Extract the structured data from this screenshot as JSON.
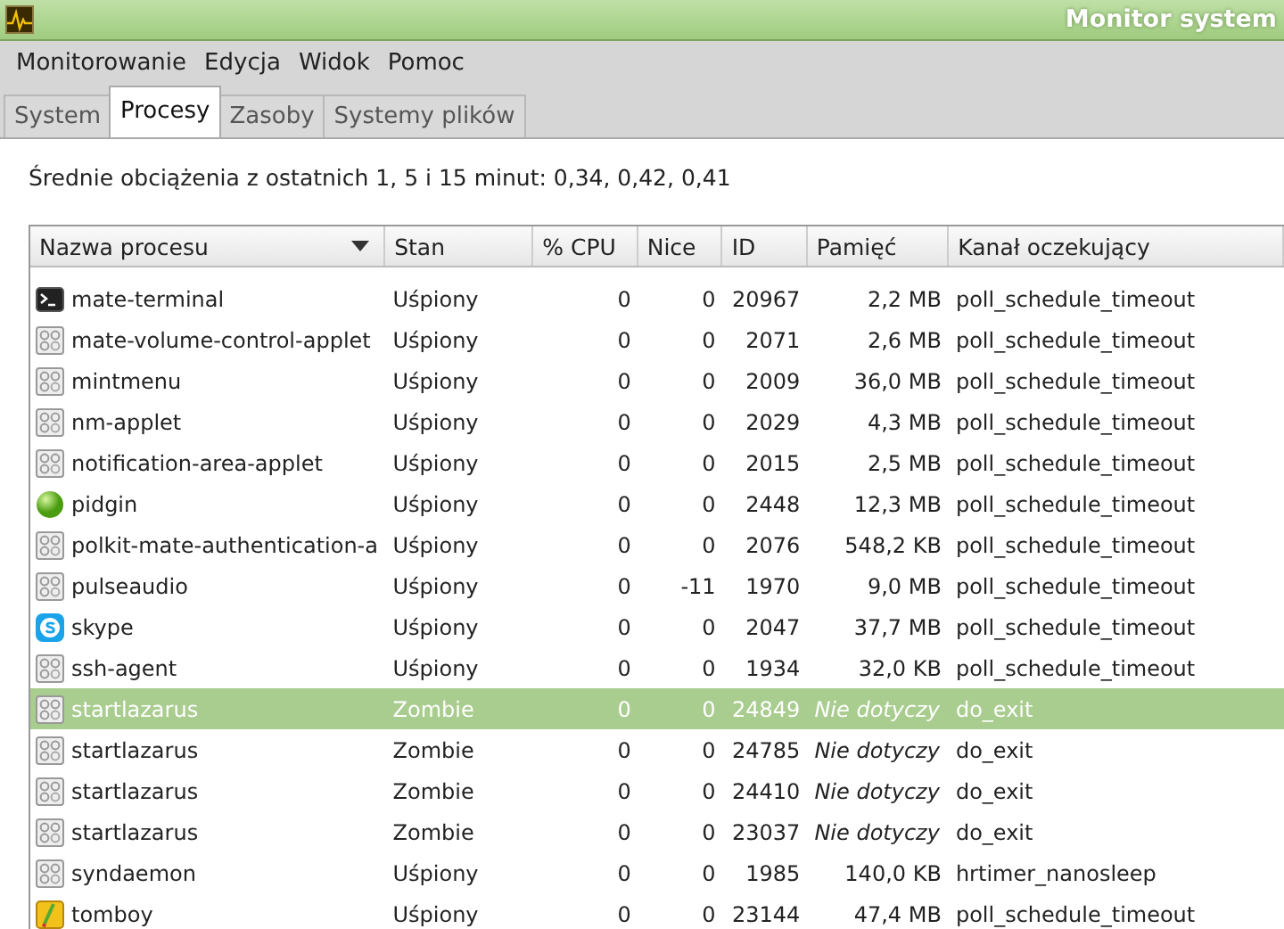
{
  "window": {
    "title": "Monitor system"
  },
  "menu": [
    "Monitorowanie",
    "Edycja",
    "Widok",
    "Pomoc"
  ],
  "tabs": [
    {
      "label": "System",
      "selected": false
    },
    {
      "label": "Procesy",
      "selected": true
    },
    {
      "label": "Zasoby",
      "selected": false
    },
    {
      "label": "Systemy plików",
      "selected": false
    }
  ],
  "load_average": "Średnie obciążenia z ostatnich 1, 5 i 15 minut: 0,34, 0,42, 0,41",
  "table": {
    "columns": [
      {
        "label": "Nazwa procesu",
        "sorted": true
      },
      {
        "label": "Stan",
        "sorted": false
      },
      {
        "label": "% CPU",
        "sorted": false
      },
      {
        "label": "Nice",
        "sorted": false
      },
      {
        "label": "ID",
        "sorted": false
      },
      {
        "label": "Pamięć",
        "sorted": false
      },
      {
        "label": "Kanał oczekujący",
        "sorted": false
      }
    ],
    "rows": [
      {
        "kind": "terminal",
        "name": "mate-terminal",
        "state": "Uśpiony",
        "cpu": "0",
        "nice": "0",
        "id": "20967",
        "memory": "2,2 MB",
        "memory_unavailable": false,
        "channel": "poll_schedule_timeout",
        "selected": false
      },
      {
        "kind": "generic",
        "name": "mate-volume-control-applet",
        "state": "Uśpiony",
        "cpu": "0",
        "nice": "0",
        "id": "2071",
        "memory": "2,6 MB",
        "memory_unavailable": false,
        "channel": "poll_schedule_timeout",
        "selected": false
      },
      {
        "kind": "generic",
        "name": "mintmenu",
        "state": "Uśpiony",
        "cpu": "0",
        "nice": "0",
        "id": "2009",
        "memory": "36,0 MB",
        "memory_unavailable": false,
        "channel": "poll_schedule_timeout",
        "selected": false
      },
      {
        "kind": "generic",
        "name": "nm-applet",
        "state": "Uśpiony",
        "cpu": "0",
        "nice": "0",
        "id": "2029",
        "memory": "4,3 MB",
        "memory_unavailable": false,
        "channel": "poll_schedule_timeout",
        "selected": false
      },
      {
        "kind": "generic",
        "name": "notification-area-applet",
        "state": "Uśpiony",
        "cpu": "0",
        "nice": "0",
        "id": "2015",
        "memory": "2,5 MB",
        "memory_unavailable": false,
        "channel": "poll_schedule_timeout",
        "selected": false
      },
      {
        "kind": "ball",
        "name": "pidgin",
        "state": "Uśpiony",
        "cpu": "0",
        "nice": "0",
        "id": "2448",
        "memory": "12,3 MB",
        "memory_unavailable": false,
        "channel": "poll_schedule_timeout",
        "selected": false
      },
      {
        "kind": "generic",
        "name": "polkit-mate-authentication-a",
        "state": "Uśpiony",
        "cpu": "0",
        "nice": "0",
        "id": "2076",
        "memory": "548,2 KB",
        "memory_unavailable": false,
        "channel": "poll_schedule_timeout",
        "selected": false
      },
      {
        "kind": "generic",
        "name": "pulseaudio",
        "state": "Uśpiony",
        "cpu": "0",
        "nice": "-11",
        "id": "1970",
        "memory": "9,0 MB",
        "memory_unavailable": false,
        "channel": "poll_schedule_timeout",
        "selected": false
      },
      {
        "kind": "skype",
        "name": "skype",
        "state": "Uśpiony",
        "cpu": "0",
        "nice": "0",
        "id": "2047",
        "memory": "37,7 MB",
        "memory_unavailable": false,
        "channel": "poll_schedule_timeout",
        "selected": false
      },
      {
        "kind": "generic",
        "name": "ssh-agent",
        "state": "Uśpiony",
        "cpu": "0",
        "nice": "0",
        "id": "1934",
        "memory": "32,0 KB",
        "memory_unavailable": false,
        "channel": "poll_schedule_timeout",
        "selected": false
      },
      {
        "kind": "generic",
        "name": "startlazarus",
        "state": "Zombie",
        "cpu": "0",
        "nice": "0",
        "id": "24849",
        "memory": "Nie dotyczy",
        "memory_unavailable": true,
        "channel": "do_exit",
        "selected": true
      },
      {
        "kind": "generic",
        "name": "startlazarus",
        "state": "Zombie",
        "cpu": "0",
        "nice": "0",
        "id": "24785",
        "memory": "Nie dotyczy",
        "memory_unavailable": true,
        "channel": "do_exit",
        "selected": false
      },
      {
        "kind": "generic",
        "name": "startlazarus",
        "state": "Zombie",
        "cpu": "0",
        "nice": "0",
        "id": "24410",
        "memory": "Nie dotyczy",
        "memory_unavailable": true,
        "channel": "do_exit",
        "selected": false
      },
      {
        "kind": "generic",
        "name": "startlazarus",
        "state": "Zombie",
        "cpu": "0",
        "nice": "0",
        "id": "23037",
        "memory": "Nie dotyczy",
        "memory_unavailable": true,
        "channel": "do_exit",
        "selected": false
      },
      {
        "kind": "generic",
        "name": "syndaemon",
        "state": "Uśpiony",
        "cpu": "0",
        "nice": "0",
        "id": "1985",
        "memory": "140,0 KB",
        "memory_unavailable": false,
        "channel": "hrtimer_nanosleep",
        "selected": false
      },
      {
        "kind": "note",
        "name": "tomboy",
        "state": "Uśpiony",
        "cpu": "0",
        "nice": "0",
        "id": "23144",
        "memory": "47,4 MB",
        "memory_unavailable": false,
        "channel": "poll_schedule_timeout",
        "selected": false
      }
    ]
  }
}
